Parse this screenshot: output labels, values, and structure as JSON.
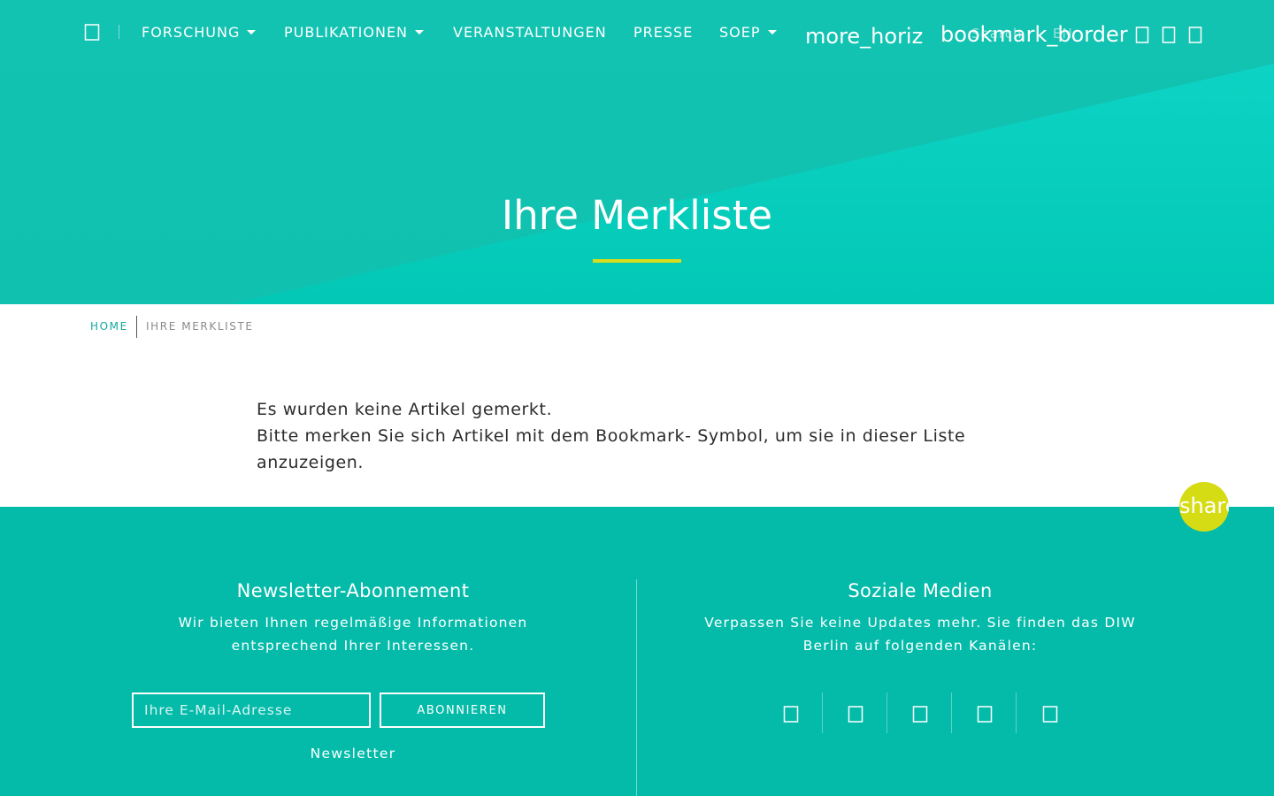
{
  "nav": {
    "items": [
      {
        "label": "FORSCHUNG",
        "has_dropdown": true
      },
      {
        "label": "PUBLIKATIONEN",
        "has_dropdown": true
      },
      {
        "label": "VERANSTALTUNGEN",
        "has_dropdown": false
      },
      {
        "label": "PRESSE",
        "has_dropdown": false
      },
      {
        "label": "SOEP",
        "has_dropdown": true
      }
    ],
    "more_icon_text": "more_horiz",
    "search_link": "Search",
    "bookmark_icon_text": "bookmark_border",
    "language_link": "EN",
    "icons": [
      "home-icon",
      "user-icon",
      "mail-icon",
      "menu-icon"
    ]
  },
  "hero": {
    "title": "Ihre Merkliste"
  },
  "breadcrumb": {
    "home": "HOME",
    "current": "IHRE MERKLISTE"
  },
  "main": {
    "line1": "Es wurden keine Artikel gemerkt.",
    "line2": "Bitte merken Sie sich Artikel mit dem Bookmark- Symbol, um sie in dieser Liste anzuzeigen."
  },
  "share": {
    "icon_text": "share"
  },
  "footer": {
    "newsletter": {
      "title": "Newsletter-Abonnement",
      "description": "Wir bieten Ihnen regelmäßige Informationen entsprechend Ihrer Interessen.",
      "email_placeholder": "Ihre E-Mail-Adresse",
      "subscribe_label": "ABONNIEREN",
      "link_label": "Newsletter"
    },
    "social": {
      "title": "Soziale Medien",
      "description": "Verpassen Sie keine Updates mehr. Sie finden das DIW Berlin auf folgenden Kanälen:",
      "icons": [
        "twitter-icon",
        "facebook-icon",
        "linkedin-icon",
        "youtube-icon",
        "instagram-icon"
      ]
    }
  },
  "colors": {
    "hero_top": "#0fd6c8",
    "hero_bottom": "#03c8b6",
    "footer_bg": "#04bbaa",
    "accent_yellow": "#d8dc1c",
    "link_teal": "#14a89c"
  }
}
